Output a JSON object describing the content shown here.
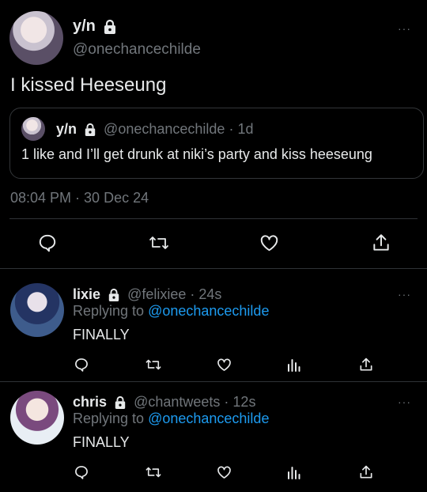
{
  "tweet": {
    "display_name": "y/n",
    "handle": "@onechancechilde",
    "text": "I kissed Heeseung",
    "timestamp": "08:04 PM · 30 Dec 24",
    "more": "···"
  },
  "quote": {
    "display_name": "y/n",
    "handle": "@onechancechilde",
    "dot": "·",
    "age": "1d",
    "text": "1 like and I’ll get drunk at niki’s party and kiss heeseung"
  },
  "replies": [
    {
      "display_name": "lixie",
      "handle": "@felixiee",
      "dot": "·",
      "age": "24s",
      "replying_prefix": "Replying to",
      "replying_to": "@onechancechilde",
      "text": "FINALLY",
      "more": "···"
    },
    {
      "display_name": "chris",
      "handle": "@chantweets",
      "dot": "·",
      "age": "12s",
      "replying_prefix": "Replying to",
      "replying_to": "@onechancechilde",
      "text": "FINALLY",
      "more": "···"
    }
  ],
  "icons": {
    "reply": "reply-icon",
    "retweet": "retweet-icon",
    "like": "heart-icon",
    "views": "analytics-icon",
    "share": "share-icon",
    "lock": "lock-icon"
  },
  "colors": {
    "background": "#000000",
    "text": "#e7e9ea",
    "muted": "#71767b",
    "link": "#1d9bf0",
    "border": "#2f3336"
  }
}
